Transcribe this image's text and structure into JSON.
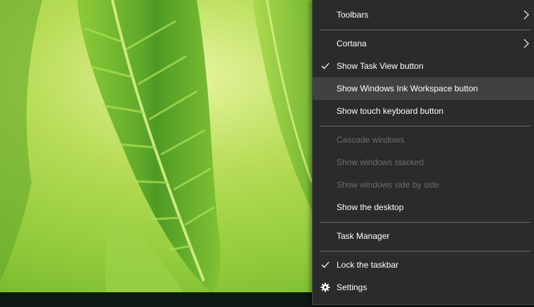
{
  "colors": {
    "menu_background": "#2b2b2b",
    "hover_background": "#414141",
    "text": "#ffffff",
    "disabled_text": "#6d6d6d",
    "separator": "#6a6a6a",
    "wallpaper_green": "#8fca3a"
  },
  "wallpaper": {
    "icon": "green-leaf-wallpaper"
  },
  "menu": {
    "toolbars": {
      "label": "Toolbars",
      "submenu_icon": "chevron-right-icon"
    },
    "cortana": {
      "label": "Cortana",
      "submenu_icon": "chevron-right-icon"
    },
    "show_task_view": {
      "label": "Show Task View button",
      "checked": true
    },
    "show_ink_workspace": {
      "label": "Show Windows Ink Workspace button",
      "hovered": true
    },
    "show_touch_keyboard": {
      "label": "Show touch keyboard button"
    },
    "cascade_windows": {
      "label": "Cascade windows",
      "enabled": false
    },
    "show_windows_stacked": {
      "label": "Show windows stacked",
      "enabled": false
    },
    "show_side_by_side": {
      "label": "Show windows side by side",
      "enabled": false
    },
    "show_desktop": {
      "label": "Show the desktop"
    },
    "task_manager": {
      "label": "Task Manager"
    },
    "lock_taskbar": {
      "label": "Lock the taskbar",
      "checked": true
    },
    "settings": {
      "label": "Settings",
      "icon": "gear-icon"
    }
  }
}
